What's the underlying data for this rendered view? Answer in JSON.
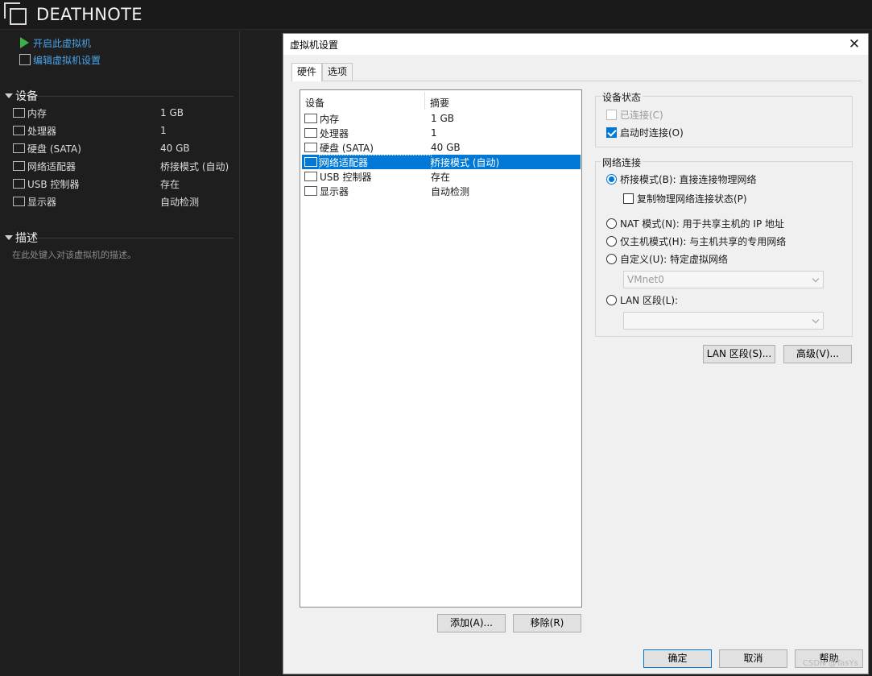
{
  "window": {
    "title": "DEATHNOTE"
  },
  "left": {
    "actions": [
      "开启此虚拟机",
      "编辑虚拟机设置"
    ],
    "devices_heading": "设备",
    "devices": [
      {
        "name": "内存",
        "value": "1 GB"
      },
      {
        "name": "处理器",
        "value": "1"
      },
      {
        "name": "硬盘 (SATA)",
        "value": "40 GB"
      },
      {
        "name": "网络适配器",
        "value": "桥接模式 (自动)"
      },
      {
        "name": "USB 控制器",
        "value": "存在"
      },
      {
        "name": "显示器",
        "value": "自动检测"
      }
    ],
    "description_heading": "描述",
    "description_placeholder": "在此处键入对该虚拟机的描述。"
  },
  "dialog": {
    "title": "虚拟机设置",
    "close": "✕",
    "tabs": [
      "硬件",
      "选项"
    ],
    "list_headers": {
      "device": "设备",
      "summary": "摘要"
    },
    "list": [
      {
        "name": "内存",
        "summary": "1 GB",
        "icon": "memory-icon"
      },
      {
        "name": "处理器",
        "summary": "1",
        "icon": "cpu-icon"
      },
      {
        "name": "硬盘 (SATA)",
        "summary": "40 GB",
        "icon": "disk-icon"
      },
      {
        "name": "网络适配器",
        "summary": "桥接模式 (自动)",
        "icon": "network-icon",
        "selected": true
      },
      {
        "name": "USB 控制器",
        "summary": "存在",
        "icon": "usb-icon"
      },
      {
        "name": "显示器",
        "summary": "自动检测",
        "icon": "monitor-icon"
      }
    ],
    "add_button": "添加(A)...",
    "remove_button": "移除(R)",
    "device_status": {
      "label": "设备状态",
      "connected": "已连接(C)",
      "connect_at_power_on": "启动时连接(O)"
    },
    "network": {
      "label": "网络连接",
      "bridged": "桥接模式(B): 直接连接物理网络",
      "replicate": "复制物理网络连接状态(P)",
      "nat": "NAT 模式(N): 用于共享主机的 IP 地址",
      "host_only": "仅主机模式(H): 与主机共享的专用网络",
      "custom": "自定义(U): 特定虚拟网络",
      "custom_value": "VMnet0",
      "lan_segment": "LAN 区段(L):",
      "lan_value": ""
    },
    "lan_segments_button": "LAN 区段(S)...",
    "advanced_button": "高级(V)...",
    "ok": "确定",
    "cancel": "取消",
    "help": "帮助"
  },
  "watermark": "CSDN @TasYs",
  "colors": {
    "accent": "#0078d7",
    "link": "#4aa3e8",
    "play": "#3cb043"
  }
}
